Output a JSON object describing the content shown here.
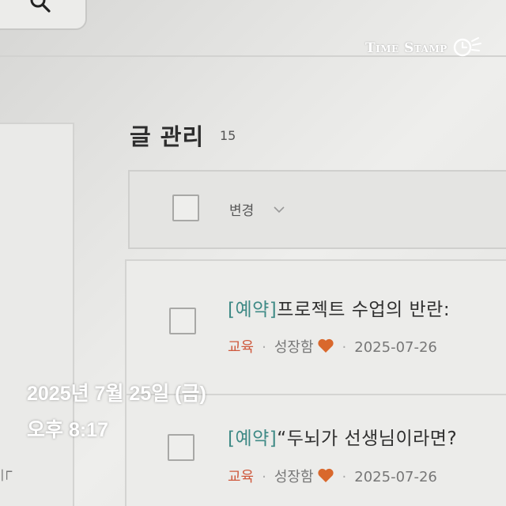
{
  "header": {
    "search_icon": "search-icon"
  },
  "left_panel": {
    "partial_text": "느"
  },
  "main": {
    "title": "글 관리",
    "count": "15",
    "toolbar": {
      "change_label": "변경",
      "chevron": "chevron-down-icon"
    },
    "posts": [
      {
        "tag": "[예약]",
        "title": "프로젝트 수업의 반란: ",
        "category": "교육",
        "author": "성장함",
        "date": "2025-07-26"
      },
      {
        "tag": "[예약]",
        "title": "“두뇌가 선생님이라면?",
        "category": "교육",
        "author": "성장함",
        "date": "2025-07-26"
      }
    ]
  },
  "overlay": {
    "date": "2025년 7월 25일 (금)",
    "time": "오후 8:17",
    "logo_text": "Time Stamp"
  },
  "colors": {
    "tag": "#3f8a86",
    "category": "#cf5a3e",
    "heart": "#d9682c",
    "overlay_text": "#ffffff"
  }
}
